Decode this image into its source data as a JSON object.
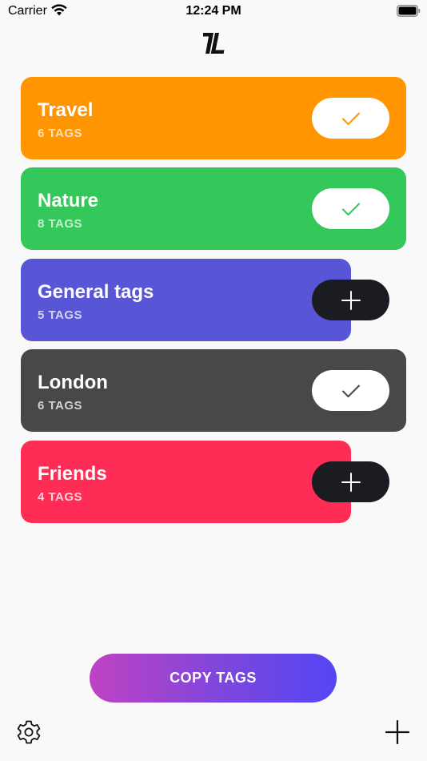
{
  "status_bar": {
    "carrier": "Carrier",
    "time": "12:24 PM"
  },
  "icons": {
    "logo": "app-logo-icon",
    "wifi": "wifi-icon",
    "battery": "battery-icon",
    "settings": "gear-icon",
    "add": "plus-icon",
    "selected": "checkmark-icon",
    "unselected": "plus-icon"
  },
  "groups": [
    {
      "title": "Travel",
      "count": "6 TAGS",
      "selected": true,
      "color": "#ff9500",
      "count_color": "#ffe0b8"
    },
    {
      "title": "Nature",
      "count": "8 TAGS",
      "selected": true,
      "color": "#34c759",
      "count_color": "#c8f0d3"
    },
    {
      "title": "General tags",
      "count": "5 TAGS",
      "selected": false,
      "color": "#5856d6",
      "count_color": "#d3d2f4"
    },
    {
      "title": "London",
      "count": "6 TAGS",
      "selected": true,
      "color": "#48484a",
      "count_color": "#d1d1d3"
    },
    {
      "title": "Friends",
      "count": "4 TAGS",
      "selected": false,
      "color": "#ff2d55",
      "count_color": "#ffd0da"
    }
  ],
  "copy_button": {
    "label": "COPY TAGS"
  },
  "colors": {
    "background": "#f9f9f9",
    "toggle_on": "#ffffff",
    "toggle_off": "#1a1c21",
    "gradient_start": "#c043c3",
    "gradient_end": "#5446f5"
  }
}
